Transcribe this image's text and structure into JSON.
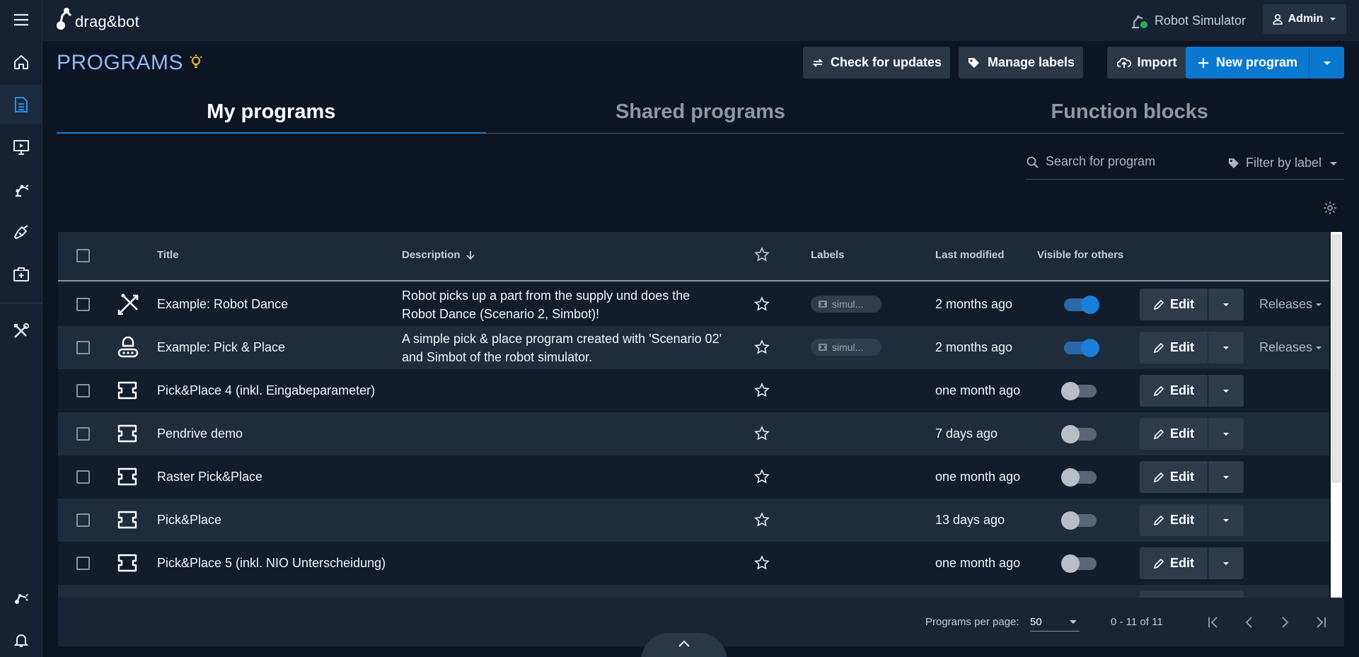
{
  "app": {
    "logo_text": "drag&bot"
  },
  "topbar": {
    "robot_simulator": "Robot Simulator",
    "user": "Admin"
  },
  "page": {
    "title": "PROGRAMS"
  },
  "actions": {
    "check_updates": "Check for updates",
    "manage_labels": "Manage labels",
    "import": "Import",
    "new_program": "New program"
  },
  "tabs": [
    {
      "label": "My programs",
      "active": true
    },
    {
      "label": "Shared programs",
      "active": false
    },
    {
      "label": "Function blocks",
      "active": false
    }
  ],
  "search": {
    "placeholder": "Search for program"
  },
  "filter": {
    "label": "Filter by label"
  },
  "table": {
    "headers": {
      "title": "Title",
      "description": "Description",
      "labels": "Labels",
      "last_modified": "Last modified",
      "visible": "Visible for others"
    },
    "rows": [
      {
        "icon": "dance-icon",
        "title": "Example: Robot Dance",
        "description_line1": "Robot picks up a part from the supply und does the",
        "description_line2": "Robot Dance (Scenario 2, Simbot)!",
        "label": "simul...",
        "modified": "2 months ago",
        "visible": true,
        "edit": "Edit",
        "releases": "Releases"
      },
      {
        "icon": "robot-icon",
        "title": "Example: Pick & Place",
        "description_line1": "A simple pick & place program created with 'Scenario 02'",
        "description_line2": "and Simbot of the robot simulator.",
        "label": "simul...",
        "modified": "2 months ago",
        "visible": true,
        "edit": "Edit",
        "releases": "Releases"
      },
      {
        "icon": "program-block-icon",
        "title": "Pick&Place 4 (inkl. Eingabeparameter)",
        "modified": "one month ago",
        "visible": false,
        "edit": "Edit"
      },
      {
        "icon": "program-block-icon",
        "title": "Pendrive demo",
        "modified": "7 days ago",
        "visible": false,
        "edit": "Edit"
      },
      {
        "icon": "program-block-icon",
        "title": "Raster Pick&Place",
        "modified": "one month ago",
        "visible": false,
        "edit": "Edit"
      },
      {
        "icon": "program-block-icon",
        "title": "Pick&Place",
        "modified": "13 days ago",
        "visible": false,
        "edit": "Edit"
      },
      {
        "icon": "program-block-icon",
        "title": "Pick&Place 5 (inkl. NIO Unterscheidung)",
        "modified": "one month ago",
        "visible": false,
        "edit": "Edit"
      }
    ]
  },
  "pagination": {
    "per_page_label": "Programs per page:",
    "per_page": "50",
    "range": "0 - 11 of 11"
  },
  "colors": {
    "accent": "#0a78cf",
    "background": "#0d1523",
    "sidebar": "#172131",
    "title": "#8fb8ee"
  }
}
